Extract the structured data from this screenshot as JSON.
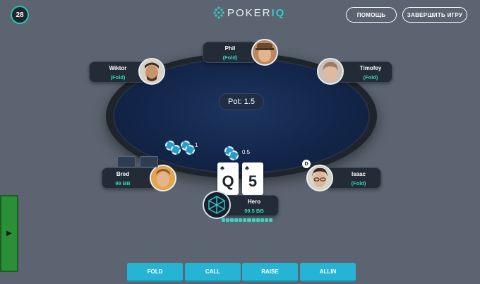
{
  "header": {
    "timer": "28",
    "logo_text": "POKER",
    "logo_text_accent": "IQ",
    "help_label": "ПОМОЩЬ",
    "finish_label": "ЗАВЕРШИТЬ ИГРУ"
  },
  "table": {
    "pot_label": "Pot: 1.5",
    "dealer_button": "D"
  },
  "players": {
    "phil": {
      "name": "Phil",
      "status": "(Fold)"
    },
    "wiktor": {
      "name": "Wiktor",
      "status": "(Fold)"
    },
    "timofey": {
      "name": "Timofey",
      "status": "(Fold)"
    },
    "bred": {
      "name": "Bred",
      "status": "99 BB",
      "bet": "1"
    },
    "isaac": {
      "name": "Isaac",
      "status": "(Fold)"
    },
    "hero": {
      "name": "Hero",
      "status": "99.5 BB",
      "bet": "0.5"
    }
  },
  "hero_cards": [
    {
      "rank": "Q",
      "suit": "♠"
    },
    {
      "rank": "5",
      "suit": "♠"
    }
  ],
  "actions": {
    "fold": "FOLD",
    "call": "CALL",
    "raise": "RAISE",
    "allin": "ALLIN"
  },
  "colors": {
    "accent": "#26b4d5",
    "status": "#39d6b8",
    "background": "#5b6470"
  },
  "icons": {
    "side_tab": "play-arrow-icon",
    "hero_avatar": "poker-iq-logo-icon"
  }
}
